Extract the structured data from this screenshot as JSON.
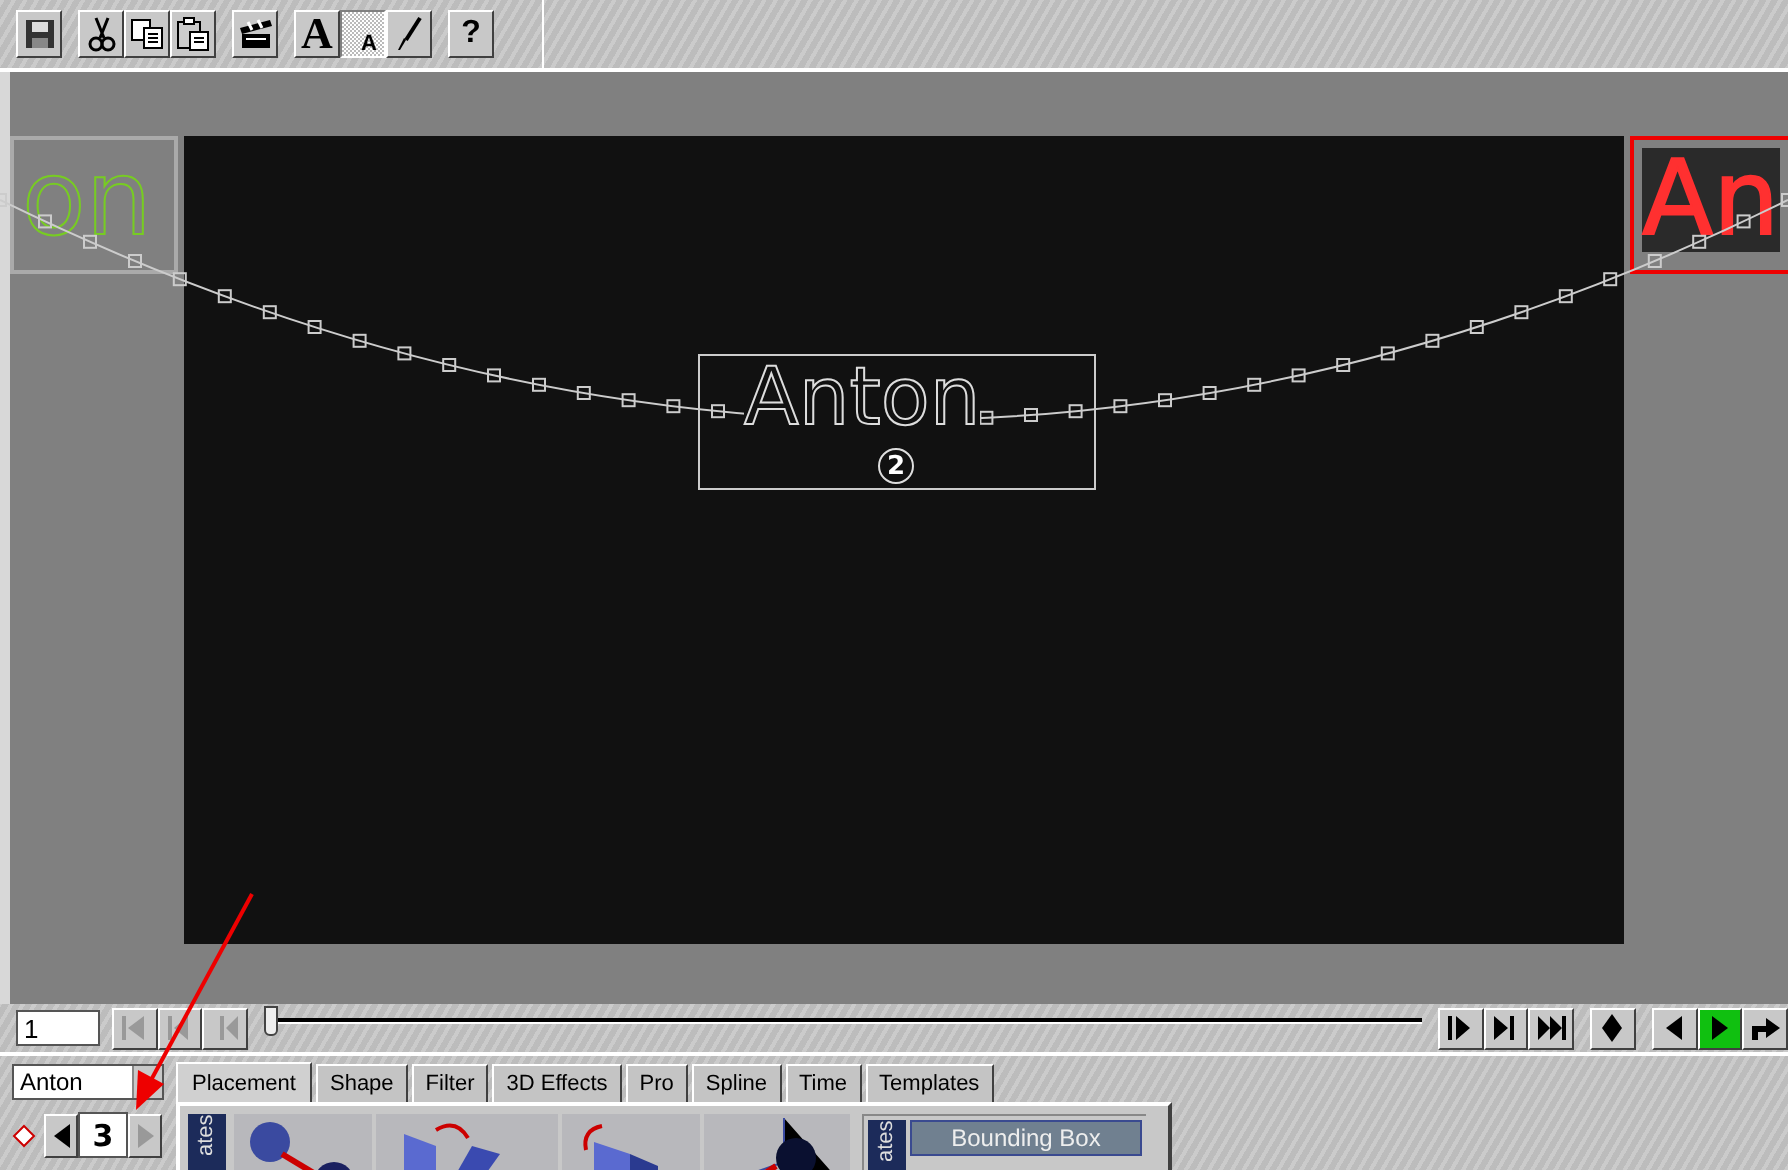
{
  "toolbar": {
    "buttons": [
      {
        "kind": "save",
        "selected": false
      },
      {
        "kind": "cut",
        "selected": false
      },
      {
        "kind": "copy",
        "selected": false
      },
      {
        "kind": "paste",
        "selected": false
      },
      {
        "kind": "clapper",
        "selected": false
      },
      {
        "kind": "text",
        "selected": false,
        "label": "A"
      },
      {
        "kind": "text-path",
        "selected": true,
        "label": "A"
      },
      {
        "kind": "brush",
        "selected": false
      },
      {
        "kind": "help",
        "selected": false,
        "label": "?"
      }
    ]
  },
  "stage": {
    "text": "Anton",
    "keyframe": "2",
    "ghost_start": "on",
    "ghost_end": "An"
  },
  "timeline": {
    "frame": "1",
    "level": 0,
    "buttons": [
      {
        "kind": "first",
        "disabled": true,
        "selected": false
      },
      {
        "kind": "prev-key",
        "disabled": true,
        "selected": false
      },
      {
        "kind": "step-back",
        "disabled": true,
        "selected": false
      },
      {
        "kind": "step",
        "disabled": false,
        "selected": false
      },
      {
        "kind": "next-key",
        "disabled": false,
        "selected": false
      },
      {
        "kind": "last",
        "disabled": false,
        "selected": false
      },
      {
        "kind": "keyframe",
        "disabled": false,
        "selected": false
      },
      {
        "kind": "reverse",
        "disabled": false,
        "selected": false
      },
      {
        "kind": "play",
        "disabled": false,
        "selected": true
      },
      {
        "kind": "loop",
        "disabled": false,
        "selected": false
      }
    ]
  },
  "object_select": {
    "value": "Anton"
  },
  "keyframe_nav": {
    "value": "3",
    "prev_disabled": false,
    "next_disabled": true
  },
  "tabs": [
    {
      "label": "Placement",
      "selected": true
    },
    {
      "label": "Shape",
      "selected": false
    },
    {
      "label": "Filter",
      "selected": false
    },
    {
      "label": "3D Effects",
      "selected": false
    },
    {
      "label": "Pro",
      "selected": false
    },
    {
      "label": "Spline",
      "selected": false
    },
    {
      "label": "Time",
      "selected": false
    },
    {
      "label": "Templates",
      "selected": false
    }
  ],
  "panel": {
    "side_label": "ates",
    "presets": [
      {
        "kind": "move"
      },
      {
        "kind": "flip"
      },
      {
        "kind": "rotate"
      },
      {
        "kind": "axis"
      }
    ],
    "states_label": "ates",
    "header": "Bounding Box"
  }
}
